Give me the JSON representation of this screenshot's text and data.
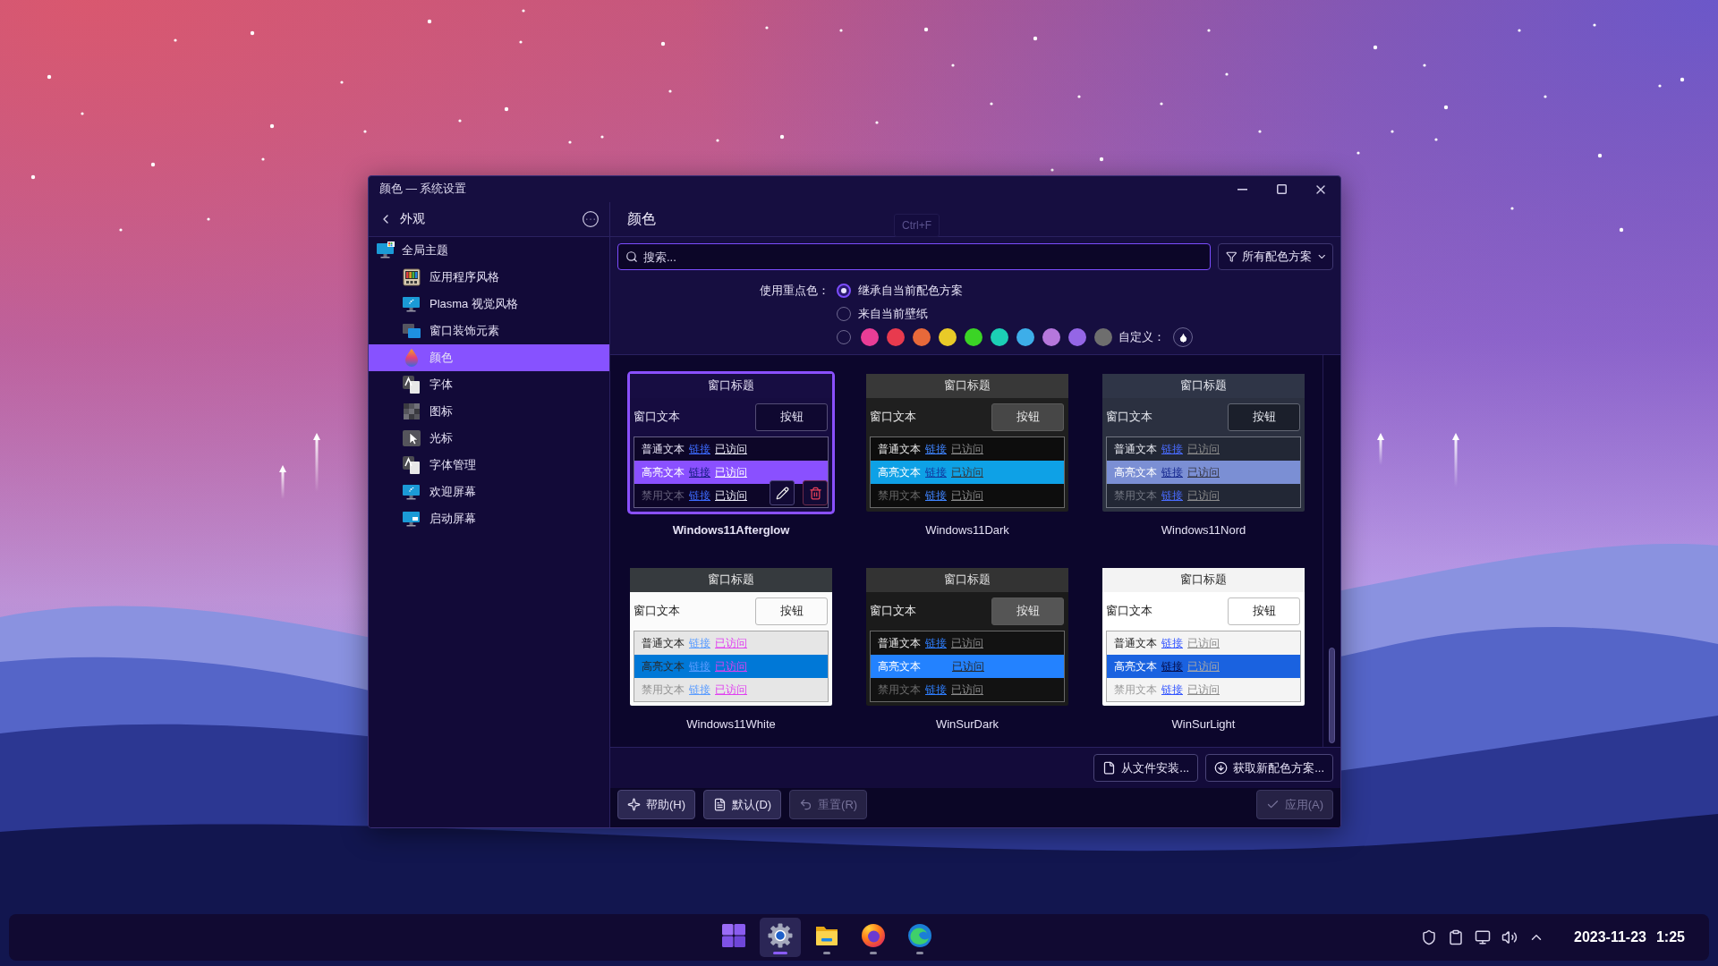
{
  "window": {
    "title": "颜色 — 系统设置"
  },
  "sidebar": {
    "title": "外观",
    "items": [
      {
        "label": "全局主题",
        "selected": false,
        "children": [
          {
            "label": "应用程序风格",
            "selected": false
          },
          {
            "label": "Plasma 视觉风格",
            "selected": false
          },
          {
            "label": "窗口装饰元素",
            "selected": false
          },
          {
            "label": "颜色",
            "selected": true
          },
          {
            "label": "字体",
            "selected": false
          },
          {
            "label": "图标",
            "selected": false
          },
          {
            "label": "光标",
            "selected": false
          },
          {
            "label": "字体管理",
            "selected": false
          },
          {
            "label": "欢迎屏幕",
            "selected": false
          },
          {
            "label": "启动屏幕",
            "selected": false
          }
        ]
      }
    ]
  },
  "page": {
    "title": "颜色",
    "shortcut_hint": "Ctrl+F"
  },
  "search": {
    "placeholder": "搜索...",
    "focused": true
  },
  "filter": {
    "label": "所有配色方案"
  },
  "accent": {
    "label": "使用重点色：",
    "options": [
      {
        "kind": "text",
        "label": "继承自当前配色方案",
        "selected": true
      },
      {
        "kind": "text",
        "label": "来自当前壁纸",
        "selected": false
      },
      {
        "kind": "colors",
        "selected": false,
        "custom_label": "自定义：",
        "swatches": [
          {
            "color": "#e93d96",
            "selected": false
          },
          {
            "color": "#e83a4e",
            "selected": false
          },
          {
            "color": "#e8693a",
            "selected": false
          },
          {
            "color": "#e9ca28",
            "selected": false
          },
          {
            "color": "#3bd425",
            "selected": false
          },
          {
            "color": "#1ccfb5",
            "selected": false
          },
          {
            "color": "#3daee9",
            "selected": false
          },
          {
            "color": "#b677dc",
            "selected": false
          },
          {
            "color": "#9466e6",
            "selected": false
          },
          {
            "color": "#6e6e6e",
            "selected": false
          }
        ]
      }
    ]
  },
  "schemes": [
    {
      "name": "Windows11Afterglow",
      "selected": true,
      "title": "窗口标题",
      "window_text": "窗口文本",
      "button": "按钮",
      "rows": [
        {
          "kind": "normal",
          "text": "普通文本",
          "link": "链接",
          "visited": "已访问"
        },
        {
          "kind": "highlight",
          "text": "高亮文本",
          "link": "链接",
          "visited": "已访问"
        },
        {
          "kind": "disabled",
          "text": "禁用文本",
          "link": "链接",
          "visited": "已访问"
        }
      ]
    },
    {
      "name": "Windows11Dark",
      "selected": false,
      "title": "窗口标题",
      "window_text": "窗口文本",
      "button": "按钮",
      "rows": [
        {
          "kind": "normal",
          "text": "普通文本",
          "link": "链接",
          "visited": "已访问"
        },
        {
          "kind": "highlight",
          "text": "高亮文本",
          "link": "链接",
          "visited": "已访问"
        },
        {
          "kind": "disabled",
          "text": "禁用文本",
          "link": "链接",
          "visited": "已访问"
        }
      ]
    },
    {
      "name": "Windows11Nord",
      "selected": false,
      "title": "窗口标题",
      "window_text": "窗口文本",
      "button": "按钮",
      "rows": [
        {
          "kind": "normal",
          "text": "普通文本",
          "link": "链接",
          "visited": "已访问"
        },
        {
          "kind": "highlight",
          "text": "高亮文本",
          "link": "链接",
          "visited": "已访问"
        },
        {
          "kind": "disabled",
          "text": "禁用文本",
          "link": "链接",
          "visited": "已访问"
        }
      ]
    },
    {
      "name": "Windows11White",
      "selected": false,
      "title": "窗口标题",
      "window_text": "窗口文本",
      "button": "按钮",
      "rows": [
        {
          "kind": "normal",
          "text": "普通文本",
          "link": "链接",
          "visited": "已访问"
        },
        {
          "kind": "highlight",
          "text": "高亮文本",
          "link": "链接",
          "visited": "已访问"
        },
        {
          "kind": "disabled",
          "text": "禁用文本",
          "link": "链接",
          "visited": "已访问"
        }
      ]
    },
    {
      "name": "WinSurDark",
      "selected": false,
      "title": "窗口标题",
      "window_text": "窗口文本",
      "button": "按钮",
      "rows": [
        {
          "kind": "normal",
          "text": "普通文本",
          "link": "链接",
          "visited": "已访问"
        },
        {
          "kind": "highlight",
          "text": "高亮文本",
          "visited": "已访问"
        },
        {
          "kind": "disabled",
          "text": "禁用文本",
          "link": "链接",
          "visited": "已访问"
        }
      ]
    },
    {
      "name": "WinSurLight",
      "selected": false,
      "title": "窗口标题",
      "window_text": "窗口文本",
      "button": "按钮",
      "rows": [
        {
          "kind": "normal",
          "text": "普通文本",
          "link": "链接",
          "visited": "已访问"
        },
        {
          "kind": "highlight",
          "text": "高亮文本",
          "link": "链接",
          "visited": "已访问"
        },
        {
          "kind": "disabled",
          "text": "禁用文本",
          "link": "链接",
          "visited": "已访问"
        }
      ]
    }
  ],
  "actions": [
    {
      "kind": "install",
      "label": "从文件安装..."
    },
    {
      "kind": "download",
      "label": "获取新配色方案..."
    }
  ],
  "footer": {
    "left": [
      {
        "kind": "help",
        "label": "帮助(H)",
        "disabled": false
      },
      {
        "kind": "defaults",
        "label": "默认(D)",
        "disabled": false
      },
      {
        "kind": "reset",
        "label": "重置(R)",
        "disabled": true
      }
    ],
    "right": [
      {
        "kind": "apply",
        "label": "应用(A)",
        "disabled": true
      }
    ]
  },
  "taskbar": {
    "apps": [
      {
        "running": false,
        "active": false
      },
      {
        "running": true,
        "active": true
      },
      {
        "running": true,
        "active": false
      },
      {
        "running": true,
        "active": false
      },
      {
        "running": true,
        "active": false
      }
    ],
    "date": "2023-11-23",
    "time": "1:25"
  }
}
